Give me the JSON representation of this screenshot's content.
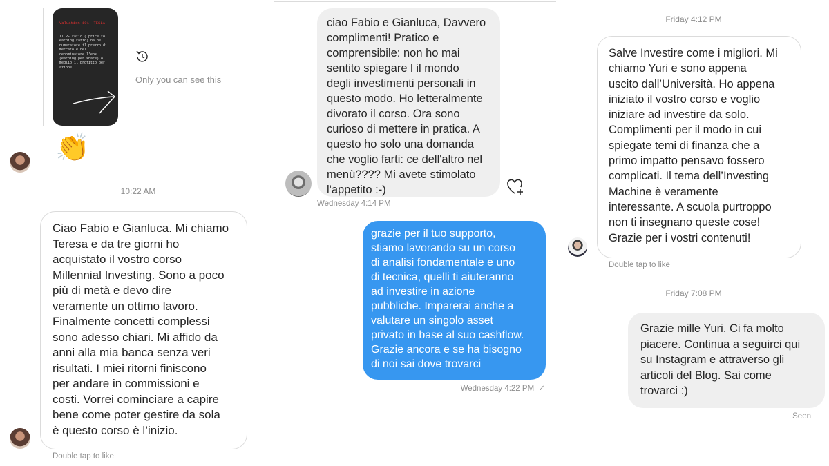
{
  "panel1": {
    "story_image": {
      "title": "Valuation 101: TESLA",
      "body": "Il PE ratio ( price to\nearning ratio) ha nel\nnumeratore il prezzo di\nmercato e nel\ndenominatore l'eps\n(earning per share) o\nmeglio il profitto per\nazione."
    },
    "private_note": "Only you can see this",
    "reaction_emoji": "👏",
    "timestamp": "10:22 AM",
    "message": "Ciao Fabio e Gianluca. Mi chiamo\nTeresa e da tre giorni ho\nacquistato il vostro corso\nMillennial Investing. Sono a poco\npiù di metà e devo dire\nveramente un ottimo lavoro.\nFinalmente concetti complessi\nsono adesso chiari. Mi affido da\nanni alla mia banca senza veri\nrisultati. I miei ritorni finiscono\nper andare in commissioni e\ncosti. Vorrei cominciare a capire\nbene come poter gestire da sola\nè questo corso è l’inizio.",
    "like_hint": "Double tap to like"
  },
  "panel2": {
    "incoming_message": "ciao Fabio e Gianluca, Davvero\ncomplimenti! Pratico e\ncomprensibile: non ho mai\nsentito spiegare l il mondo\ndegli investimenti personali in\nquesto modo. Ho letteralmente\ndivorato il corso. Ora sono\ncurioso di mettere in pratica. A\nquesto ho solo una domanda\nche voglio farti: ce dell'altro nel\nmenù???? Mi avete stimolato\nl'appetito :-)",
    "incoming_timestamp": "Wednesday 4:14 PM",
    "outgoing_message": "grazie per il tuo supporto,\nstiamo lavorando su un corso\ndi analisi fondamentale e uno\ndi tecnica, quelli ti aiuteranno\nad investire in azione\npubbliche. Imparerai anche a\nvalutare un singolo asset\nprivato in base al suo cashflow.\nGrazie ancora e se ha bisogno\ndi noi sai dove trovarci",
    "outgoing_timestamp": "Wednesday 4:22 PM",
    "delivered_mark": "✓"
  },
  "panel3": {
    "timestamp_top": "Friday 4:12 PM",
    "incoming_message": "Salve Investire come i migliori. Mi\nchiamo Yuri e sono appena\nuscito dall’Università. Ho appena\niniziato il vostro corso e voglio\niniziare ad investire da solo.\nComplimenti per il modo in cui\nspiegate temi di finanza che a\nprimo impatto pensavo fossero\ncomplicati. Il tema dell’Investing\nMachine è veramente\ninteressante. A scuola purtroppo\nnon ti insegnano queste cose!\nGrazie per i vostri contenuti!",
    "like_hint": "Double tap to like",
    "timestamp_bottom": "Friday 7:08 PM",
    "reply_message": "Grazie mille Yuri. Ci fa molto\npiacere. Continua a seguirci qui\nsu Instagram e attraverso gli\narticoli del Blog. Sai come\ntrovarci :)",
    "seen_label": "Seen"
  },
  "icons": {
    "history": "history-icon",
    "heart_add": "heart-add-icon"
  },
  "colors": {
    "outgoing_bubble": "#3797f0",
    "incoming_grey": "#efefef",
    "meta_text": "#8e8e8e"
  }
}
